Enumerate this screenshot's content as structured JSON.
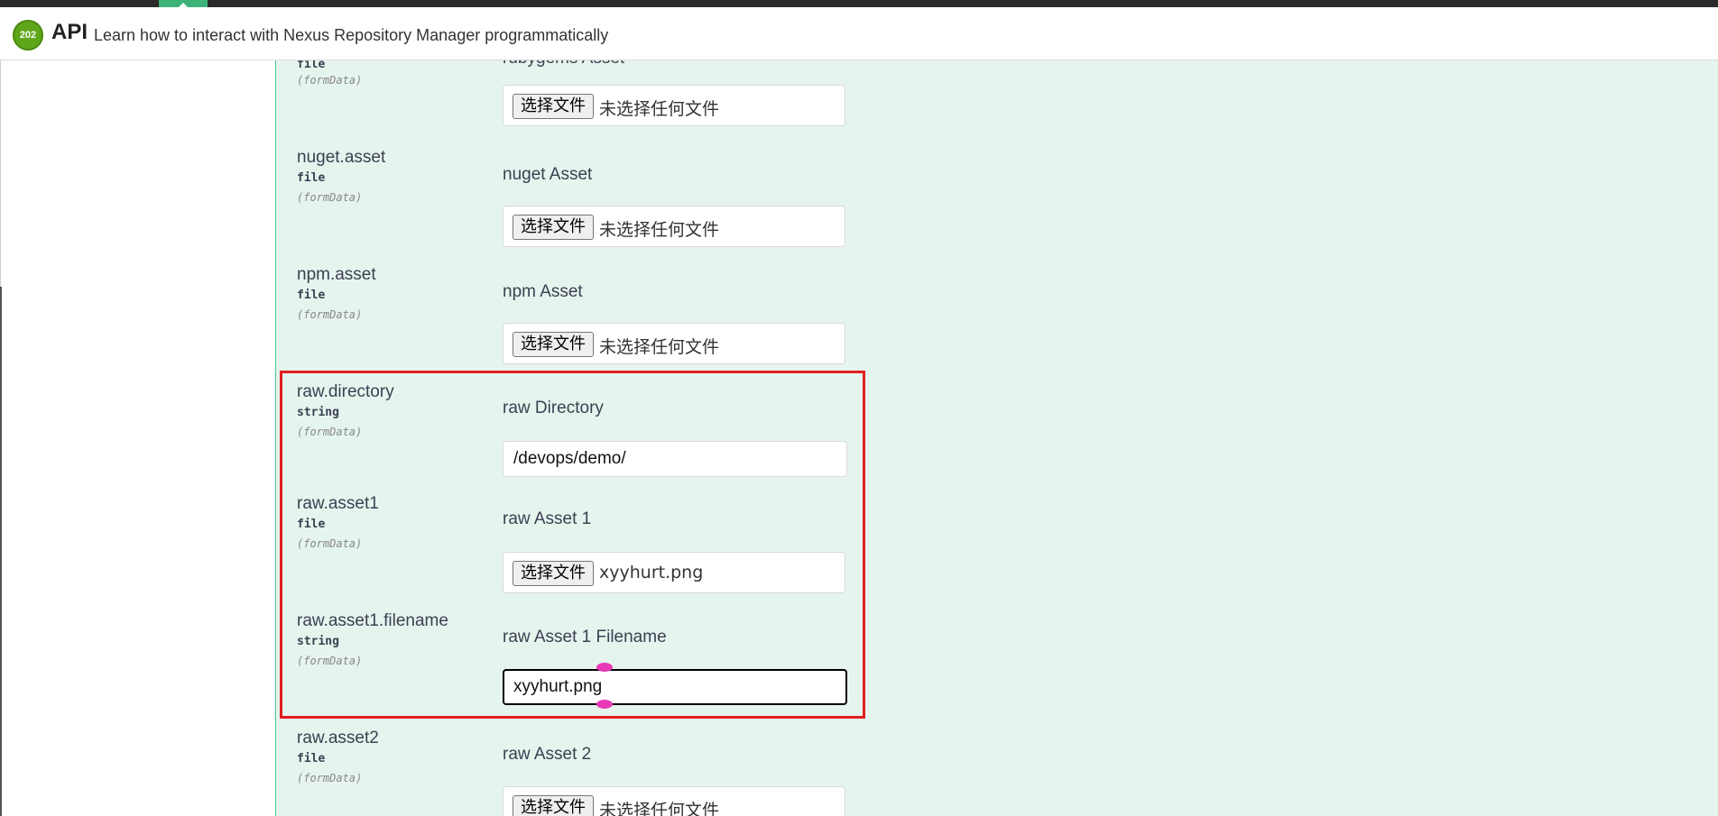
{
  "header": {
    "status_code": "202",
    "title": "API",
    "subtitle": "Learn how to interact with Nexus Repository Manager programmatically"
  },
  "file_button_label": "选择文件",
  "no_file_text": "未选择任何文件",
  "params": {
    "rubygems": {
      "type": "file",
      "in": "(formData)",
      "description_partial": "rubygems Asset"
    },
    "nuget": {
      "name": "nuget.asset",
      "type": "file",
      "in": "(formData)",
      "description": "nuget Asset"
    },
    "npm": {
      "name": "npm.asset",
      "type": "file",
      "in": "(formData)",
      "description": "npm Asset"
    },
    "raw_directory": {
      "name": "raw.directory",
      "type": "string",
      "in": "(formData)",
      "description": "raw Directory",
      "value": "/devops/demo/"
    },
    "raw_asset1": {
      "name": "raw.asset1",
      "type": "file",
      "in": "(formData)",
      "description": "raw Asset 1",
      "selected_file": "xyyhurt.png"
    },
    "raw_asset1_filename": {
      "name": "raw.asset1.filename",
      "type": "string",
      "in": "(formData)",
      "description": "raw Asset 1 Filename",
      "value": "xyyhurt.png"
    },
    "raw_asset2": {
      "name": "raw.asset2",
      "type": "file",
      "in": "(formData)",
      "description": "raw Asset 2"
    }
  },
  "colors": {
    "panel_bg": "#e6f4ee",
    "panel_border": "#49cc90",
    "highlight": "#e02020",
    "badge": "#5fa61b",
    "handle": "#e83ab8"
  }
}
